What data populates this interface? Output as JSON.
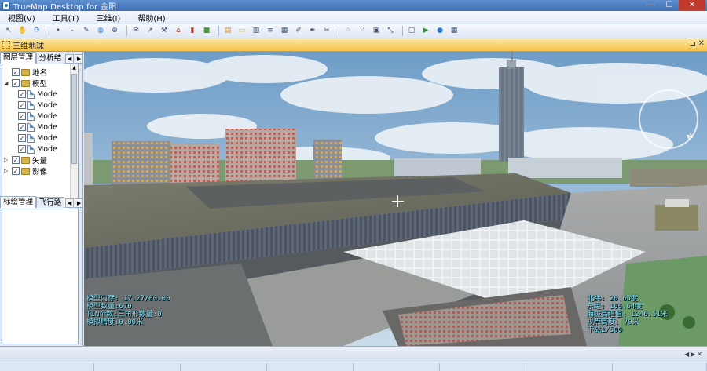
{
  "window": {
    "title": "TrueMap Desktop for 金阳"
  },
  "menu": [
    "视图(V)",
    "工具(T)",
    "三维(I)",
    "帮助(H)"
  ],
  "toolbar": {
    "icons": [
      "select-arrow-icon",
      "hand-icon",
      "refresh-icon",
      "dot-icon",
      "dash-icon",
      "edit-icon",
      "globe-icon",
      "zoom-icon",
      "mail-icon",
      "cursor-tool-icon",
      "wrench-icon",
      "house-red-icon",
      "bookmark-red-icon",
      "cube-green-icon",
      "layers-orange-icon",
      "folder-open-icon",
      "ruler-icon",
      "measure-icon",
      "chart-icon",
      "brush-icon",
      "pen-icon",
      "cut-icon",
      "scatter-icon",
      "scatter2-icon",
      "camera-icon",
      "move-icon",
      "window-icon",
      "export-icon",
      "globe-blue-icon",
      "grid-icon"
    ]
  },
  "document": {
    "title": "三维地球"
  },
  "left_panel": {
    "tabs_top": [
      "图层管理",
      "分析结"
    ],
    "tree": [
      {
        "label": "地名",
        "level": 1,
        "checked": true,
        "type": "folder",
        "expand": ""
      },
      {
        "label": "模型",
        "level": 1,
        "checked": true,
        "type": "folder",
        "expand": "◢"
      },
      {
        "label": "Mode",
        "level": 2,
        "checked": true,
        "type": "file"
      },
      {
        "label": "Mode",
        "level": 2,
        "checked": true,
        "type": "file"
      },
      {
        "label": "Mode",
        "level": 2,
        "checked": true,
        "type": "file"
      },
      {
        "label": "Mode",
        "level": 2,
        "checked": true,
        "type": "file"
      },
      {
        "label": "Mode",
        "level": 2,
        "checked": true,
        "type": "file"
      },
      {
        "label": "Mode",
        "level": 2,
        "checked": true,
        "type": "file"
      },
      {
        "label": "矢量",
        "level": 1,
        "checked": true,
        "type": "folder",
        "expand": "▷"
      },
      {
        "label": "影像",
        "level": 1,
        "checked": true,
        "type": "folder",
        "expand": "▷"
      }
    ],
    "tabs_bottom": [
      "标绘管理",
      "飞行路"
    ]
  },
  "hud_left": [
    "模型内存: 17.27/80.00",
    "模型数量:670",
    "TIN个数:三角形数量:0",
    "模拟精度:0.00米"
  ],
  "hud_right": [
    "北纬: 26.65度",
    "东经: 106.64度",
    "海拔高程值: 1246.51米",
    "视点高度: 70米",
    "下载1/500"
  ],
  "compass": {
    "label": "N"
  },
  "colors": {
    "titlebar": "#4a7dc0",
    "document_tab": "#f6c34a",
    "hud_text": "#7fe8ff"
  }
}
